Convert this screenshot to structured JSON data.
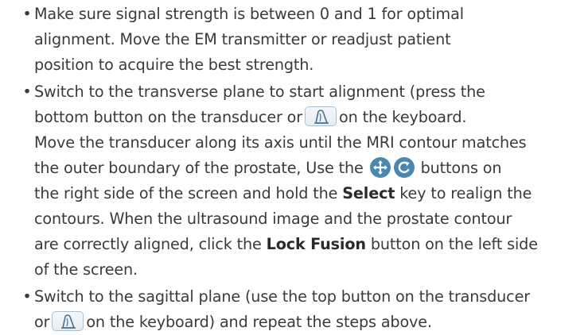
{
  "bullets": [
    {
      "lines": [
        "Make sure signal strength is between 0 and 1 for optimal",
        "alignment. Move the EM transmitter or readjust patient",
        "position to acquire the best strength."
      ]
    },
    {
      "l1": "Switch to the transverse plane to start alignment (press the",
      "l2a": "bottom button on the transducer or",
      "l2b": "on the keyboard.",
      "l3": "Move the transducer along its axis until the MRI contour matches",
      "l4a": "the outer boundary of the prostate, Use the",
      "l4b": "buttons on",
      "l5a": "the right side of the screen and hold the",
      "l5bold": "Select",
      "l5b": "key to realign the",
      "l6": "contours. When the ultrasound image and the prostate contour",
      "l7a": "are correctly aligned, click the",
      "l7bold": "Lock Fusion",
      "l7b": "button on the left side",
      "l8": "of the screen."
    },
    {
      "l1": "Switch to the sagittal plane (use the top button on the transducer",
      "l2a": "or",
      "l2b": "on the keyboard) and repeat the steps above."
    }
  ],
  "bullet_char": "•",
  "icons": {
    "key_icon": "transducer-probe-icon",
    "move_icon": "move-arrows-icon",
    "rotate_icon": "rotate-icon"
  },
  "colors": {
    "text": "#3a3a3a",
    "icon_blue": "#4b87b0",
    "key_border": "#aac0cf"
  }
}
